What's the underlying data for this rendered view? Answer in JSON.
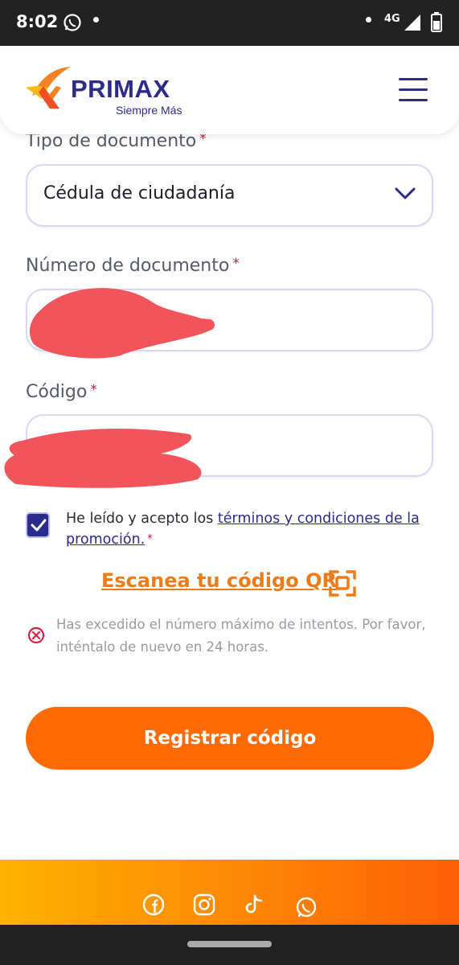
{
  "status_bar": {
    "time": "8:02",
    "network": "4G"
  },
  "header": {
    "brand": "PRIMAX",
    "tagline": "Siempre Más",
    "brand_color": "#2a2a8f",
    "accent_color": "#f07a14",
    "menu_icon": "hamburger-menu-icon"
  },
  "form": {
    "document_type": {
      "label": "Tipo de documento",
      "required_mark": "*",
      "value": "Cédula de ciudadanía"
    },
    "document_number": {
      "label": "Número de documento",
      "required_mark": "*"
    },
    "code": {
      "label": "Código",
      "required_mark": "*"
    },
    "terms": {
      "checked": true,
      "text_before": "He leído y acepto los ",
      "link_text": "términos y condiciones de la promoción.",
      "required_mark": "*"
    },
    "scan_qr_label": "Escanea tu código QR",
    "error_message": "Has excedido el número máximo de intentos. Por favor, inténtalo de nuevo en 24 horas.",
    "submit_label": "Registrar código"
  },
  "footer": {
    "social_icons": [
      "facebook-icon",
      "instagram-icon",
      "tiktok-icon",
      "whatsapp-icon"
    ]
  }
}
